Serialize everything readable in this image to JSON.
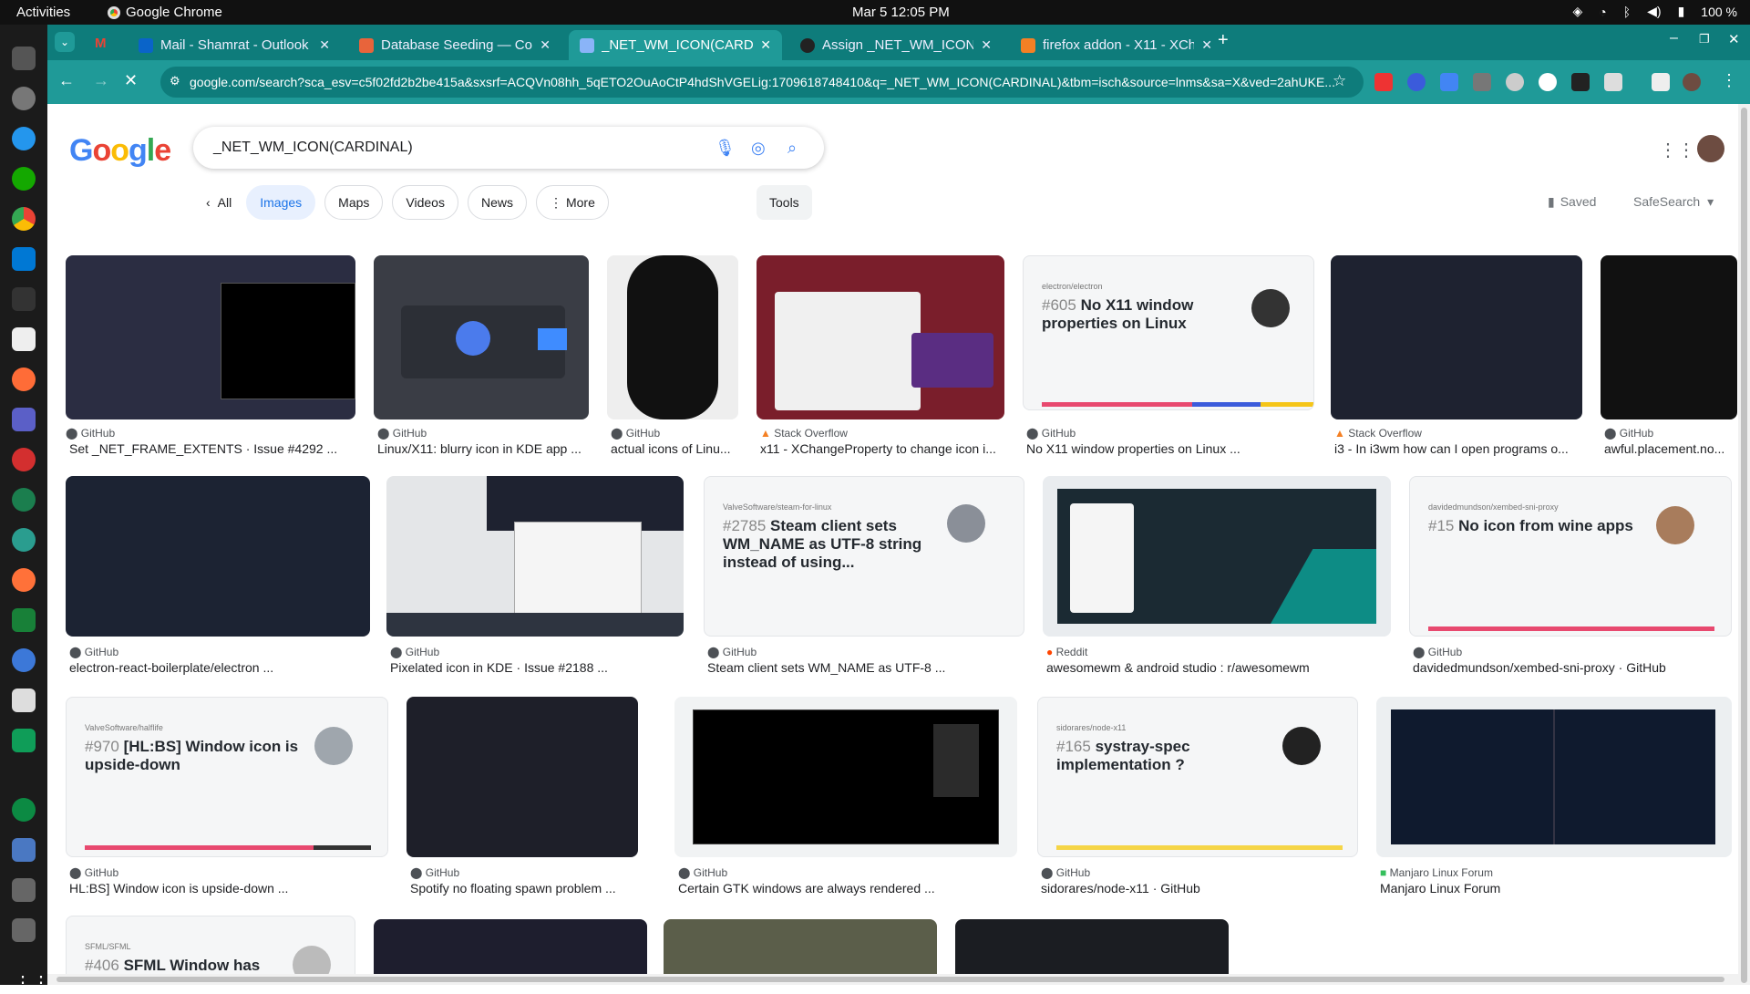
{
  "system": {
    "activities": "Activities",
    "app_name": "Google Chrome",
    "clock": "Mar 5  12:05 PM",
    "battery": "100 %"
  },
  "tabs": [
    {
      "title": "Mail - Shamrat - Outlook",
      "color": "#0a64c9"
    },
    {
      "title": "Database Seeding — Co",
      "color": "#e8643b"
    },
    {
      "title": "_NET_WM_ICON(CARDI",
      "color": "#8ab4f8"
    },
    {
      "title": "Assign _NET_WM_ICON",
      "color": "#222222"
    },
    {
      "title": "firefox addon - X11 - XCh",
      "color": "#f48024"
    }
  ],
  "url": "google.com/search?sca_esv=c5f02fd2b2be415a&sxsrf=ACQVn08hh_5qETO2OuAoCtP4hdShVGELig:1709618748410&q=_NET_WM_ICON(CARDINAL)&tbm=isch&source=lnms&sa=X&ved=2ahUKE...",
  "search": {
    "query": "_NET_WM_ICON(CARDINAL)"
  },
  "logo": "Google",
  "chips": {
    "all": "All",
    "images": "Images",
    "maps": "Maps",
    "videos": "Videos",
    "news": "News",
    "more": "More"
  },
  "tools": "Tools",
  "saved": "Saved",
  "safesearch": "SafeSearch",
  "rows": [
    [
      {
        "source": "GitHub",
        "caption": "Set _NET_FRAME_EXTENTS · Issue #4292 ..."
      },
      {
        "source": "GitHub",
        "caption": "Linux/X11: blurry icon in KDE app ..."
      },
      {
        "source": "GitHub",
        "caption": "actual icons of Linu..."
      },
      {
        "source": "Stack Overflow",
        "caption": "x11 - XChangeProperty to change icon i..."
      },
      {
        "source": "GitHub",
        "caption": "No X11 window properties on Linux ...",
        "repo": "electron/electron",
        "num": "#605",
        "title": "No X11 window properties on Linux"
      },
      {
        "source": "Stack Overflow",
        "caption": "i3 - In i3wm how can I open programs o..."
      },
      {
        "source": "GitHub",
        "caption": "awful.placement.no..."
      }
    ],
    [
      {
        "source": "GitHub",
        "caption": "electron-react-boilerplate/electron ..."
      },
      {
        "source": "GitHub",
        "caption": "Pixelated icon in KDE · Issue #2188 ..."
      },
      {
        "source": "GitHub",
        "caption": "Steam client sets WM_NAME as UTF-8 ...",
        "repo": "ValveSoftware/steam-for-linux",
        "num": "#2785",
        "title": "Steam client sets WM_NAME as UTF-8 string instead of using..."
      },
      {
        "source": "Reddit",
        "caption": "awesomewm & android studio : r/awesomewm"
      },
      {
        "source": "GitHub",
        "caption": "davidedmundson/xembed-sni-proxy · GitHub",
        "repo": "davidedmundson/xembed-sni-proxy",
        "num": "#15",
        "title": "No icon from wine apps"
      }
    ],
    [
      {
        "source": "GitHub",
        "caption": "HL:BS] Window icon is upside-down ...",
        "repo": "ValveSoftware/halflife",
        "num": "#970",
        "title": "[HL:BS] Window icon is upside-down"
      },
      {
        "source": "GitHub",
        "caption": "Spotify no floating spawn problem ..."
      },
      {
        "source": "GitHub",
        "caption": "Certain GTK windows are always rendered ..."
      },
      {
        "source": "GitHub",
        "caption": "sidorares/node-x11 · GitHub",
        "repo": "sidorares/node-x11",
        "num": "#165",
        "title": "systray-spec implementation ?"
      },
      {
        "source": "Manjaro Linux Forum",
        "caption": "Manjaro Linux Forum"
      }
    ],
    [
      {
        "repo": "SFML/SFML",
        "num": "#406",
        "title": "SFML Window has"
      }
    ]
  ]
}
